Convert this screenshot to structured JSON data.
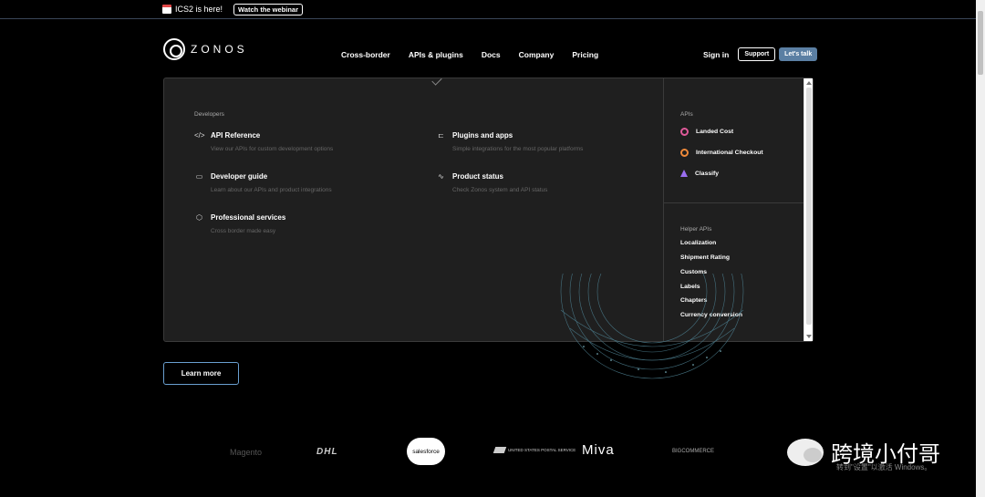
{
  "announcement": {
    "text": "ICS2 is here!",
    "button": "Watch the webinar"
  },
  "brand": {
    "name": "ZONOS"
  },
  "nav": {
    "items": [
      "Cross-border",
      "APIs & plugins",
      "Docs",
      "Company",
      "Pricing"
    ]
  },
  "right_nav": {
    "sign_in": "Sign in",
    "support": "Support",
    "talk": "Let's talk"
  },
  "dropdown": {
    "developers_heading": "Developers",
    "developers": [
      {
        "icon": "code-icon",
        "title": "API Reference",
        "desc": "View our APIs for custom development options"
      },
      {
        "icon": "plug-icon",
        "title": "Plugins and apps",
        "desc": "Simple integrations for the most popular platforms"
      },
      {
        "icon": "laptop-icon",
        "title": "Developer guide",
        "desc": "Learn about our APIs and product integrations"
      },
      {
        "icon": "pulse-icon",
        "title": "Product status",
        "desc": "Check Zonos system and API status"
      },
      {
        "icon": "hexagon-icon",
        "title": "Professional services",
        "desc": "Cross border made easy"
      }
    ],
    "apis_heading": "APIs",
    "apis": [
      "Landed Cost",
      "International Checkout",
      "Classify"
    ],
    "helper_heading": "Helper APIs",
    "helpers": [
      "Localization",
      "Shipment Rating",
      "Customs",
      "Labels",
      "Chapters",
      "Currency conversion"
    ]
  },
  "hero": {
    "learn_more": "Learn more"
  },
  "partners": {
    "magento": "Magento",
    "dhl": "DHL",
    "salesforce": "salesforce",
    "usps": "UNITED STATES POSTAL SERVICE",
    "miva": "Miva",
    "bigcommerce": "BIGCOMMERCE"
  },
  "watermark": {
    "text": "跨境小付哥",
    "windows": "转到\"设置\"以激活 Windows。"
  },
  "colors": {
    "accent": "#5b7fa3",
    "panel": "#1f1f1f",
    "landed": "#e05a9a",
    "checkout": "#f08a3a",
    "classify": "#9a6ef0"
  }
}
